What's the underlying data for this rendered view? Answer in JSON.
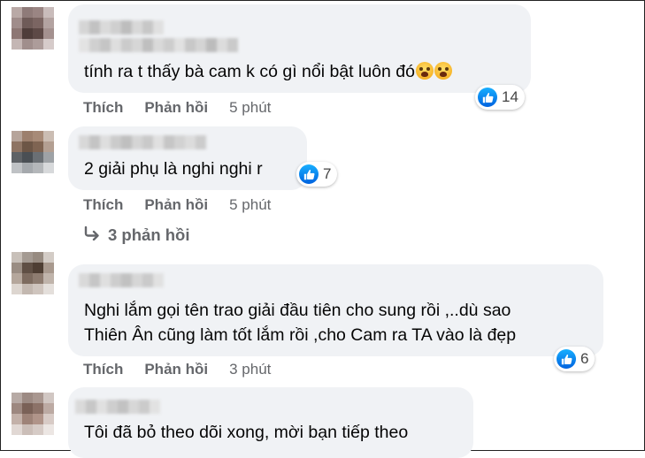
{
  "comments": [
    {
      "text_lines": [
        "tính ra t thấy bà cam k có gì nổi bật luôn đó"
      ],
      "emojis": [
        "crying-face-icon",
        "crying-face-icon"
      ],
      "reaction": {
        "icon": "like-icon",
        "count": "14"
      },
      "actions": {
        "like": "Thích",
        "reply": "Phản hồi",
        "time": "5 phút"
      }
    },
    {
      "text_lines": [
        "2 giải phụ là nghi nghi r"
      ],
      "reaction": {
        "icon": "like-icon",
        "count": "7"
      },
      "actions": {
        "like": "Thích",
        "reply": "Phản hồi",
        "time": "5 phút"
      }
    },
    {
      "text_lines": [
        "Nghi lắm gọi tên trao giải đầu tiên cho sung rồi ,..dù sao",
        "Thiên Ân cũng làm tốt lắm rồi ,cho Cam ra TA vào là đẹp"
      ],
      "reaction": {
        "icon": "like-icon",
        "count": "6"
      },
      "actions": {
        "like": "Thích",
        "reply": "Phản hồi",
        "time": "3 phút"
      }
    },
    {
      "text_lines": [
        "Tôi đã bỏ theo dõi xong, mời bạn tiếp theo"
      ]
    }
  ],
  "view_replies": {
    "icon": "reply-arrow-icon",
    "label": "3 phản hồi"
  },
  "colors": {
    "bubble": "#f0f2f5",
    "text": "#050505",
    "secondary": "#65676b",
    "like_blue": "#1877f2"
  }
}
